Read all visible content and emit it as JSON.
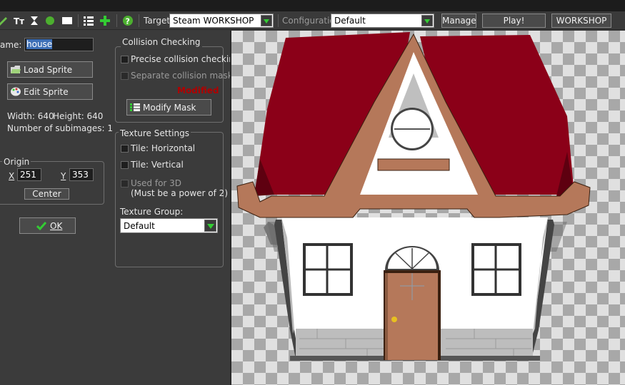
{
  "toolbar": {
    "target_label": "Target:",
    "target_value": "Steam WORKSHOP",
    "config_label": "Configuration:",
    "config_value": "Default",
    "manage_label": "Manage",
    "play_label": "Play!",
    "workshop_label": "WORKSHOP",
    "icons": [
      "pencil-icon",
      "font-icon",
      "hourglass-icon",
      "green-circle-icon",
      "white-rect-icon",
      "list-icon",
      "add-icon",
      "help-icon"
    ]
  },
  "sprite": {
    "name_label": "Name:",
    "name_value": "house",
    "load_label": "Load Sprite",
    "edit_label": "Edit Sprite",
    "width_label": "Width: 640",
    "height_label": "Height: 640",
    "subimages_label": "Number of subimages: 1",
    "origin_title": "Origin",
    "x_label": "X",
    "x_value": "251",
    "y_label": "Y",
    "y_value": "353",
    "center_label": "Center",
    "ok_label": "OK"
  },
  "collision": {
    "title": "Collision Checking",
    "precise_label": "Precise collision checking",
    "separate_label": "Separate collision masks",
    "modified_label": "Modified",
    "modify_mask_label": "Modify Mask"
  },
  "texture": {
    "title": "Texture Settings",
    "tile_h_label": "Tile: Horizontal",
    "tile_v_label": "Tile: Vertical",
    "used3d_label": "Used for 3D",
    "power2_label": "(Must be a power of 2)",
    "group_label": "Texture Group:",
    "group_value": "Default"
  },
  "colors": {
    "roof": "#8b0018",
    "trim": "#b5785a",
    "wall": "#ffffff",
    "door": "#b5785a",
    "accent_green": "#33cc33",
    "modified_red": "#b00000"
  }
}
